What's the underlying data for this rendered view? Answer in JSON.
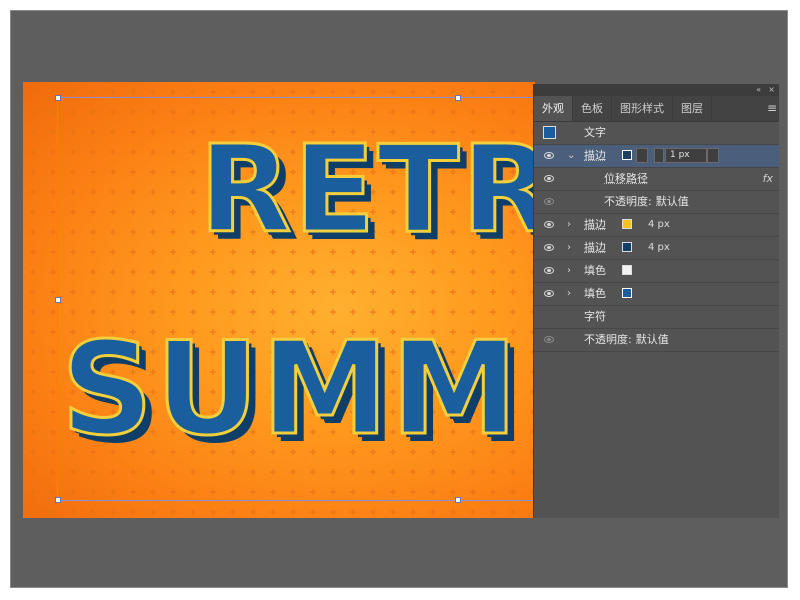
{
  "artboard": {
    "word1": "RETR",
    "word2": "SUMM"
  },
  "panel": {
    "collapse_icon": "«",
    "close_icon": "×",
    "tabs": [
      {
        "label": "外观"
      },
      {
        "label": "色板"
      },
      {
        "label": "图形样式"
      },
      {
        "label": "图层"
      }
    ],
    "menu_icon": "≡",
    "header": {
      "label": "文字"
    },
    "rows": [
      {
        "label": "描边",
        "value": "1 px",
        "swatch": "#1e3f63"
      },
      {
        "label": "位移路径",
        "fx": "fx"
      },
      {
        "label": "不透明度",
        "value": "默认值"
      },
      {
        "label": "描边",
        "value": "4 px",
        "swatch": "#f5c320"
      },
      {
        "label": "描边",
        "value": "4 px",
        "swatch": "#0f3f68"
      },
      {
        "label": "填色",
        "swatch": "#f2f2f2"
      },
      {
        "label": "填色",
        "swatch": "#1a5e9e"
      },
      {
        "label": "字符"
      },
      {
        "label": "不透明度",
        "value": "默认值"
      }
    ]
  },
  "colors": {
    "accent": "#ff9a1f",
    "text_fill": "#1a5e9e",
    "text_stroke": "#f2cf3b",
    "text_shadow": "#0f3f68"
  }
}
